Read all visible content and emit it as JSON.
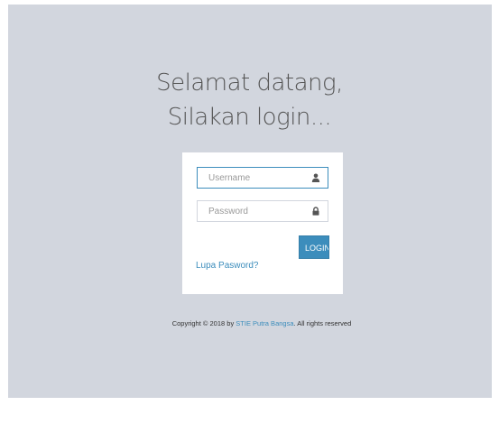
{
  "welcome": {
    "line1": "Selamat datang,",
    "line2": "Silakan login..."
  },
  "form": {
    "username_placeholder": "Username",
    "username_value": "",
    "password_placeholder": "Password",
    "password_value": "",
    "login_label": "LOGIN",
    "forgot_label": "Lupa Pasword?"
  },
  "footer": {
    "prefix": "Copyright © 2018 by ",
    "brand": "STIE Putra Bangsa",
    "suffix": ". All rights reserved"
  },
  "icons": {
    "username": "user-icon",
    "password": "lock-icon"
  },
  "colors": {
    "background": "#d2d6de",
    "accent": "#3c8dbc",
    "panel": "#ffffff"
  }
}
